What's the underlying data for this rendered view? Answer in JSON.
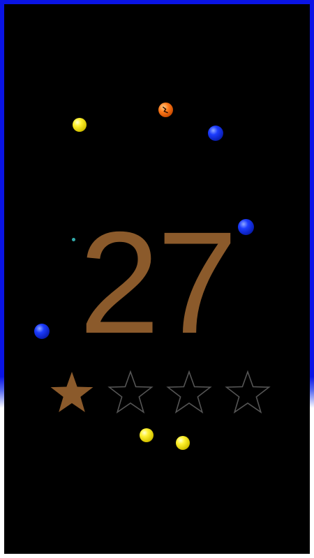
{
  "game": {
    "score": "27",
    "stars": {
      "earned": 1,
      "total": 4
    },
    "colors": {
      "border": "#0a14e6",
      "background": "#000000",
      "score": "#8b5a2b",
      "star_filled": "#8b5a2b",
      "star_empty_outline": "#555555",
      "ball_yellow": "#fff233",
      "ball_blue": "#1c3cff",
      "ball_orange": "#ff7a1a",
      "ball_cyan": "#33aaaa"
    },
    "balls": [
      {
        "name": "ball-yellow",
        "color": "yellow"
      },
      {
        "name": "ball-orange-cracked",
        "color": "orange"
      },
      {
        "name": "ball-blue",
        "color": "blue"
      },
      {
        "name": "ball-blue",
        "color": "blue"
      },
      {
        "name": "ball-cyan-small",
        "color": "cyan"
      },
      {
        "name": "ball-blue",
        "color": "blue"
      },
      {
        "name": "ball-yellow",
        "color": "yellow"
      },
      {
        "name": "ball-yellow",
        "color": "yellow"
      }
    ]
  }
}
